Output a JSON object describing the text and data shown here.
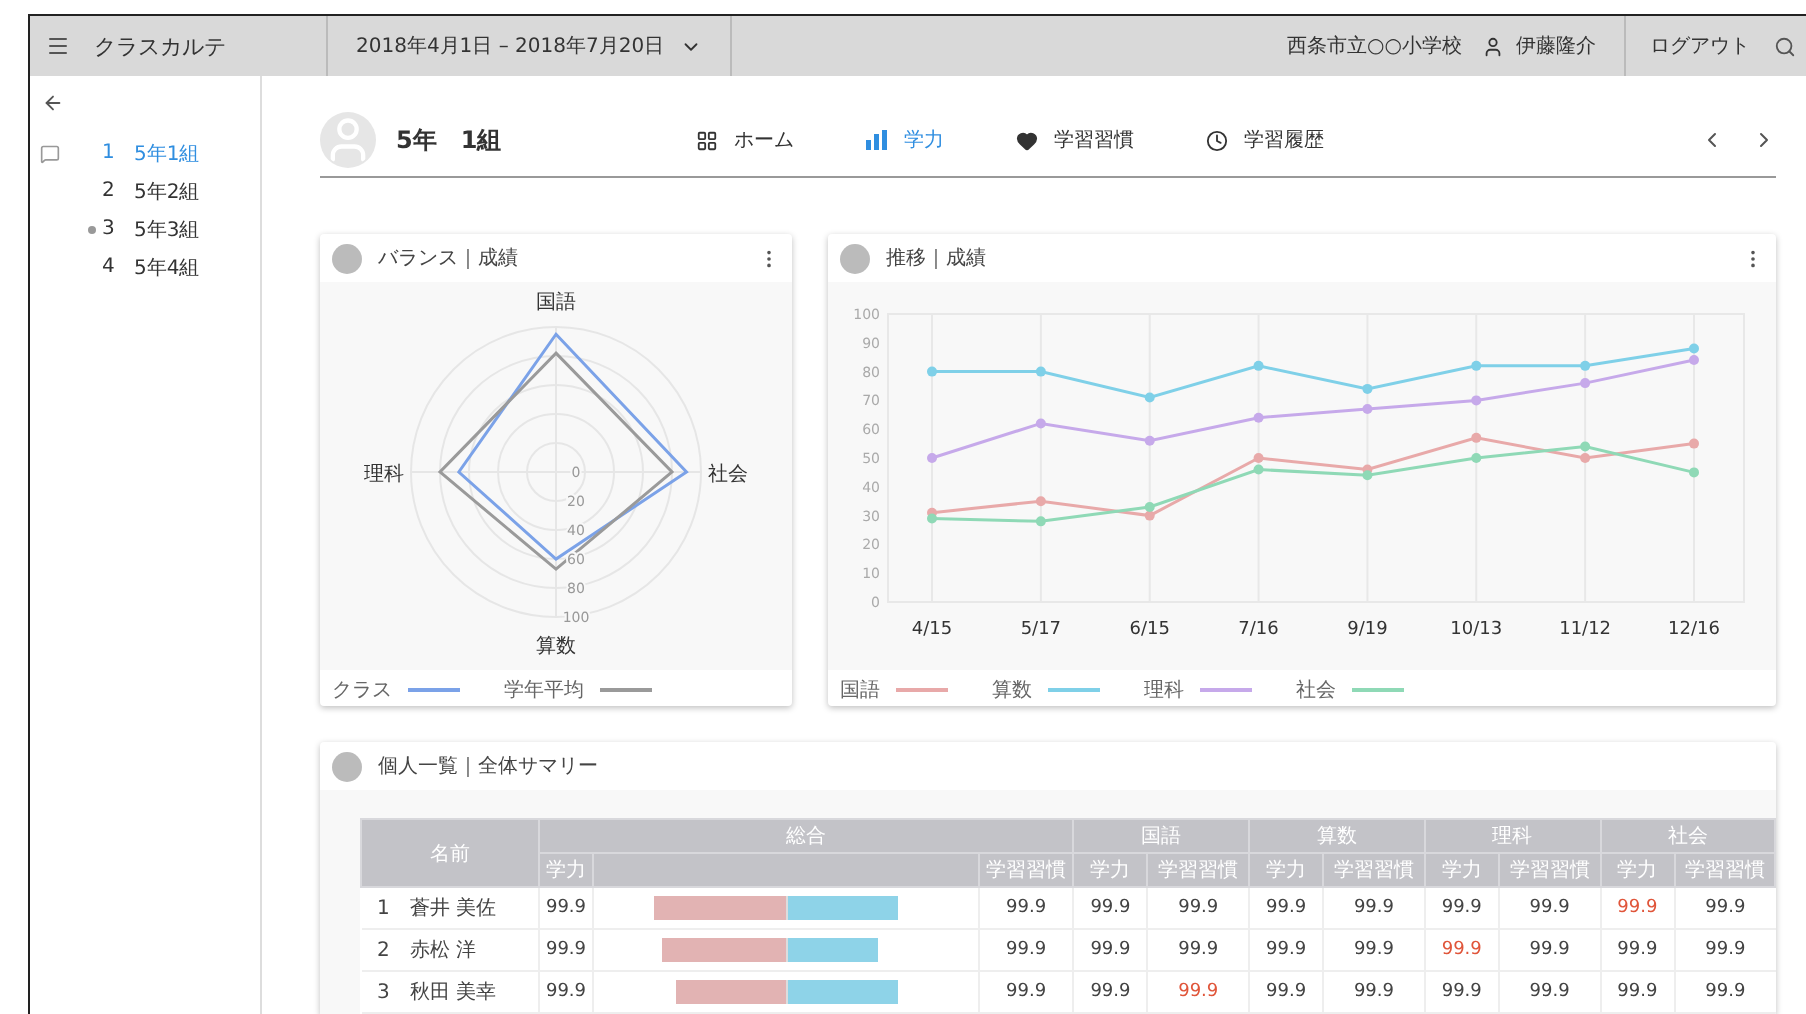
{
  "header": {
    "title": "クラスカルテ",
    "date_range": "2018年4月1日 – 2018年7月20日",
    "school": "西条市立○○小学校",
    "user": "伊藤隆介",
    "logout": "ログアウト"
  },
  "sidebar": {
    "items": [
      {
        "number": "1",
        "label": "5年1組",
        "selected": true,
        "marked": false
      },
      {
        "number": "2",
        "label": "5年2組",
        "selected": false,
        "marked": false
      },
      {
        "number": "3",
        "label": "5年3組",
        "selected": false,
        "marked": true
      },
      {
        "number": "4",
        "label": "5年4組",
        "selected": false,
        "marked": false
      }
    ]
  },
  "class_header": {
    "title": "5年　1組",
    "tabs": [
      {
        "label": "ホーム",
        "kind": "home",
        "selected": false
      },
      {
        "label": "学力",
        "kind": "ability",
        "selected": true
      },
      {
        "label": "学習習慣",
        "kind": "habit",
        "selected": false
      },
      {
        "label": "学習履歴",
        "kind": "history",
        "selected": false
      }
    ]
  },
  "balance_card": {
    "title": "バランス｜成績",
    "axes": [
      "国語",
      "社会",
      "算数",
      "理科"
    ],
    "ticks": [
      "0",
      "20",
      "40",
      "60",
      "80",
      "100"
    ],
    "legend": [
      {
        "name": "クラス",
        "color": "#7ba2e8"
      },
      {
        "name": "学年平均",
        "color": "#9a9a9a"
      }
    ]
  },
  "trend_card": {
    "title": "推移｜成績",
    "chart_data": {
      "type": "line",
      "grid": true,
      "legend": "bottom",
      "categories": [
        "4/15",
        "5/17",
        "6/15",
        "7/16",
        "9/19",
        "10/13",
        "11/12",
        "12/16"
      ],
      "ylim": [
        0,
        100
      ],
      "yticks": [
        0,
        10,
        20,
        30,
        40,
        50,
        60,
        70,
        80,
        90,
        100
      ],
      "series": [
        {
          "name": "国語",
          "color": "#e8a9a9",
          "marker": "circle",
          "values": [
            31,
            35,
            30,
            50,
            46,
            57,
            50,
            55
          ]
        },
        {
          "name": "算数",
          "color": "#7fd0e8",
          "marker": "circle",
          "values": [
            80,
            80,
            71,
            82,
            74,
            82,
            82,
            88
          ]
        },
        {
          "name": "理科",
          "color": "#c6a9ea",
          "marker": "circle",
          "values": [
            50,
            62,
            56,
            64,
            67,
            70,
            76,
            84
          ]
        },
        {
          "name": "社会",
          "color": "#8fd9b6",
          "marker": "circle",
          "values": [
            29,
            28,
            33,
            46,
            44,
            50,
            54,
            45
          ]
        }
      ]
    }
  },
  "summary_card": {
    "title": "個人一覧｜全体サマリー",
    "table": {
      "name_column": "名前",
      "groups": [
        {
          "label": "総合",
          "kind": "summary",
          "subcolumns": [
            "学力",
            "学習習慣"
          ]
        },
        {
          "label": "国語",
          "kind": "subject",
          "subcolumns": [
            "学力",
            "学習習慣"
          ]
        },
        {
          "label": "算数",
          "kind": "subject",
          "subcolumns": [
            "学力",
            "学習習慣"
          ]
        },
        {
          "label": "理科",
          "kind": "subject",
          "subcolumns": [
            "学力",
            "学習習慣"
          ]
        },
        {
          "label": "社会",
          "kind": "subject",
          "subcolumns": [
            "学力",
            "学習習慣"
          ]
        }
      ],
      "rows": [
        {
          "number": "1",
          "name": "蒼井 美佐",
          "ability": "99.9",
          "habit": "99.9",
          "habit_bar": {
            "level": 0.7
          },
          "scores": [
            {
              "value": "99.9",
              "alert": false
            },
            {
              "value": "99.9",
              "alert": false
            },
            {
              "value": "99.9",
              "alert": false
            },
            {
              "value": "99.9",
              "alert": false
            },
            {
              "value": "99.9",
              "alert": false
            },
            {
              "value": "99.9",
              "alert": false
            },
            {
              "value": "99.9",
              "alert": true
            },
            {
              "value": "99.9",
              "alert": false
            }
          ]
        },
        {
          "number": "2",
          "name": "赤松 洋",
          "ability": "99.9",
          "habit": "99.9",
          "habit_bar": {
            "level": 0.57
          },
          "scores": [
            {
              "value": "99.9",
              "alert": false
            },
            {
              "value": "99.9",
              "alert": false
            },
            {
              "value": "99.9",
              "alert": false
            },
            {
              "value": "99.9",
              "alert": false
            },
            {
              "value": "99.9",
              "alert": true
            },
            {
              "value": "99.9",
              "alert": false
            },
            {
              "value": "99.9",
              "alert": false
            },
            {
              "value": "99.9",
              "alert": false
            }
          ]
        },
        {
          "number": "3",
          "name": "秋田 美幸",
          "ability": "99.9",
          "habit": "99.9",
          "habit_bar": {
            "level": 0.7
          },
          "scores": [
            {
              "value": "99.9",
              "alert": false
            },
            {
              "value": "99.9",
              "alert": true
            },
            {
              "value": "99.9",
              "alert": false
            },
            {
              "value": "99.9",
              "alert": false
            },
            {
              "value": "99.9",
              "alert": false
            },
            {
              "value": "99.9",
              "alert": false
            },
            {
              "value": "99.9",
              "alert": false
            },
            {
              "value": "99.9",
              "alert": false
            }
          ]
        }
      ]
    }
  }
}
